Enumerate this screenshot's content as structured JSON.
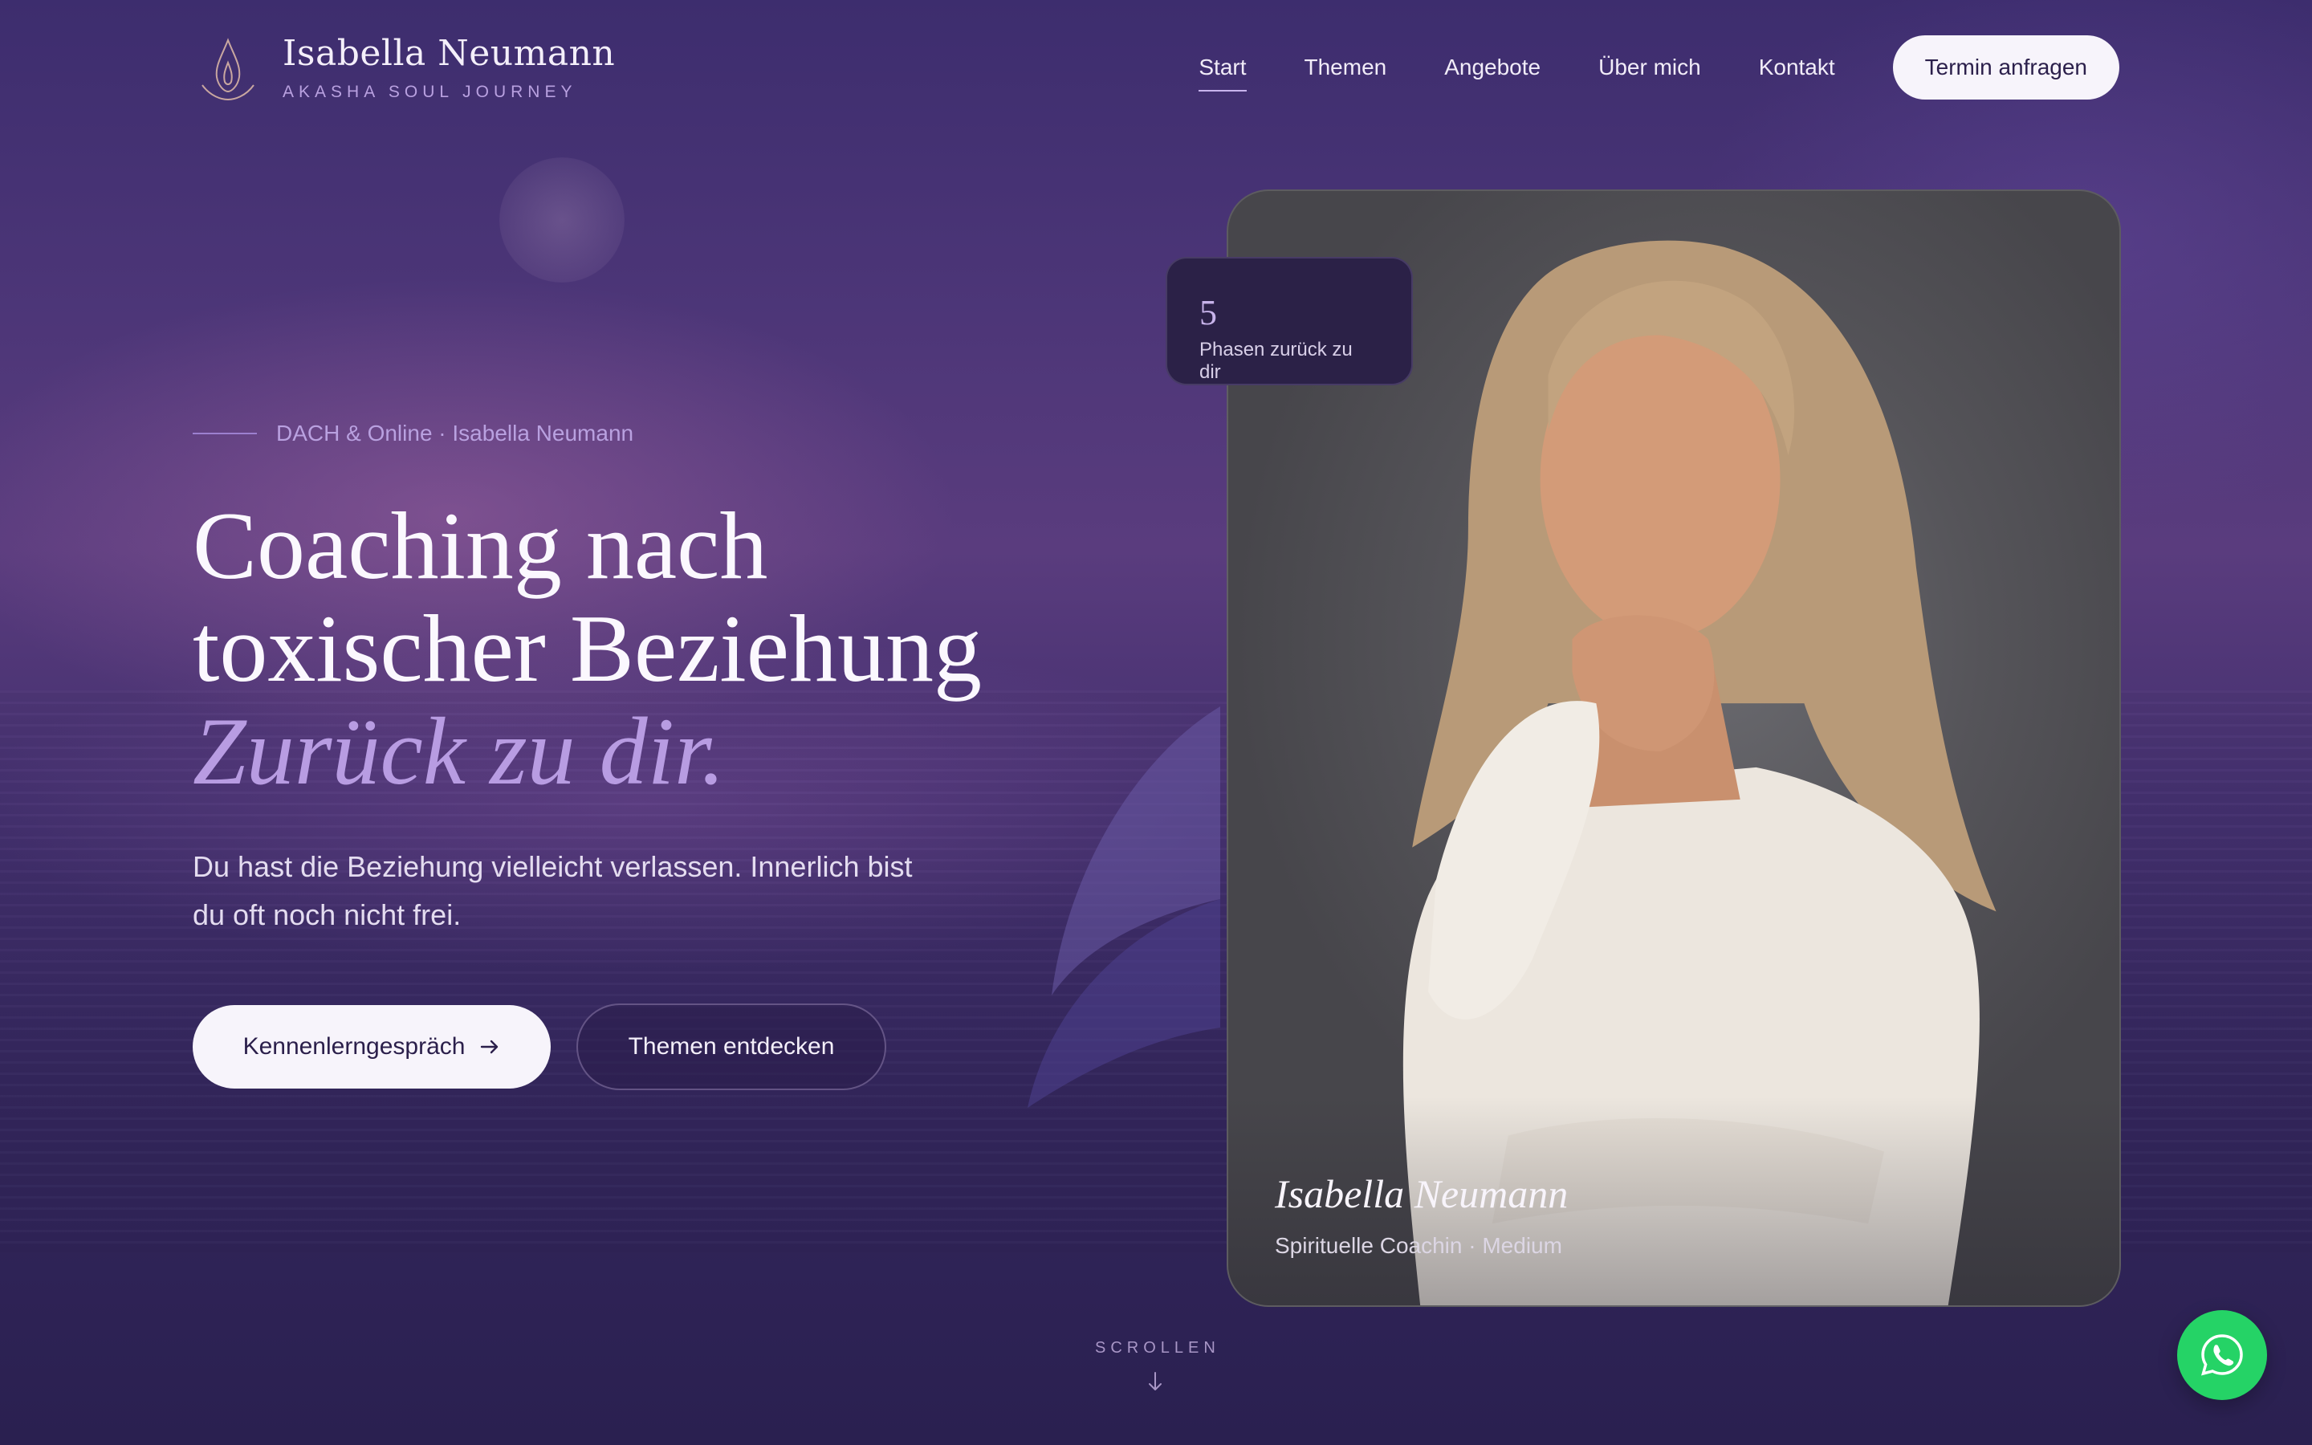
{
  "brand": {
    "name": "Isabella Neumann",
    "tagline": "AKASHA SOUL JOURNEY",
    "logo_icon": "flame-lotus-icon"
  },
  "nav": {
    "items": [
      {
        "label": "Start",
        "active": true
      },
      {
        "label": "Themen",
        "active": false
      },
      {
        "label": "Angebote",
        "active": false
      },
      {
        "label": "Über mich",
        "active": false
      },
      {
        "label": "Kontakt",
        "active": false
      }
    ],
    "cta": "Termin anfragen"
  },
  "hero": {
    "eyebrow": "DACH & Online · Isabella Neumann",
    "headline_line1": "Coaching nach",
    "headline_line2": "toxischer Beziehung",
    "headline_accent": "Zurück zu dir.",
    "lead": "Du hast die Beziehung vielleicht verlassen. Innerlich bist du oft noch nicht frei.",
    "primary_button": "Kennenlerngespräch",
    "primary_button_icon": "arrow-right-icon",
    "secondary_button": "Themen entdecken"
  },
  "stat": {
    "number": "5",
    "label": "Phasen zurück zu dir"
  },
  "portrait": {
    "name": "Isabella Neumann",
    "role": "Spirituelle Coachin · Medium"
  },
  "scroll": {
    "label": "SCROLLEN",
    "icon": "arrow-down-icon"
  },
  "floating": {
    "icon": "whatsapp-icon"
  },
  "colors": {
    "accent": "#b89ce2",
    "background": "#3d2d6e",
    "whatsapp": "#25d366"
  }
}
